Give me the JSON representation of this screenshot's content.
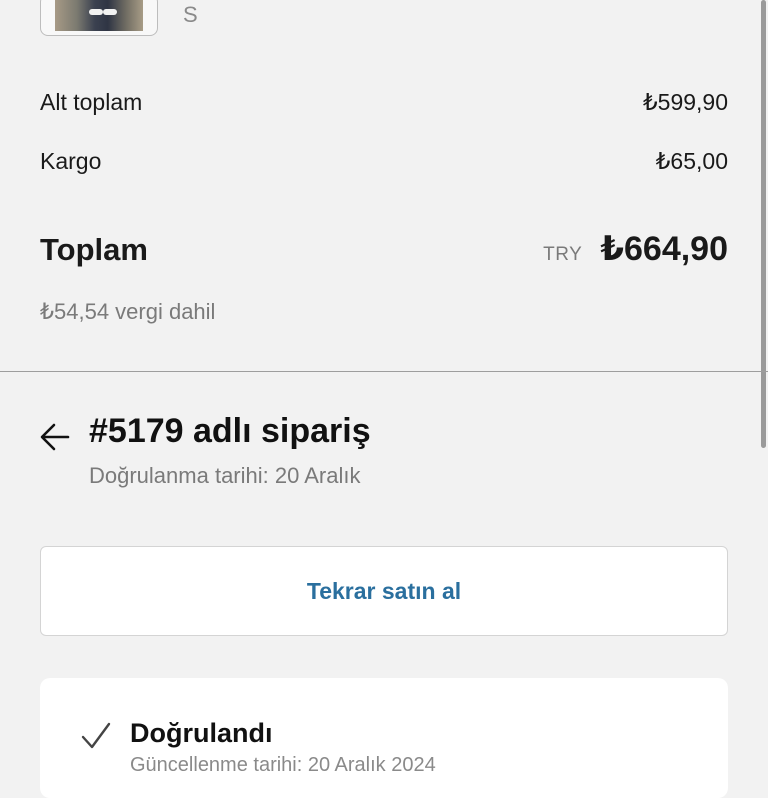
{
  "line_item": {
    "variant": "S"
  },
  "summary": {
    "subtotal_label": "Alt toplam",
    "subtotal_value": "₺599,90",
    "shipping_label": "Kargo",
    "shipping_value": "₺65,00",
    "total_label": "Toplam",
    "currency_code": "TRY",
    "total_value": "₺664,90",
    "tax_note": "₺54,54 vergi dahil"
  },
  "order": {
    "back_icon": "arrow-left-icon",
    "title": "#5179 adlı sipariş",
    "confirmed_date": "Doğrulanma tarihi: 20 Aralık",
    "rebuy_label": "Tekrar satın al"
  },
  "status": {
    "icon": "checkmark-icon",
    "title": "Doğrulandı",
    "updated_date": "Güncellenme tarihi: 20 Aralık 2024"
  },
  "colors": {
    "background": "#f2f2f2",
    "link": "#2a6f9e",
    "card": "#ffffff"
  }
}
